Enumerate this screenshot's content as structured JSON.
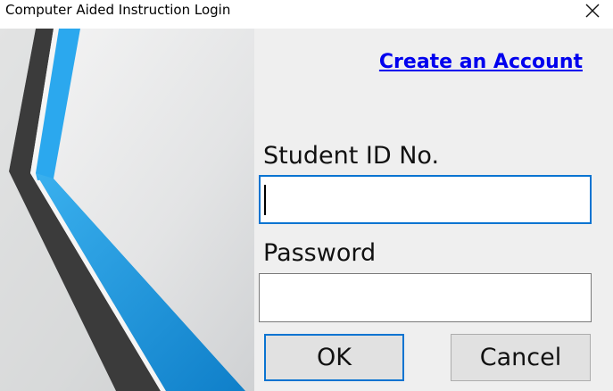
{
  "window": {
    "title": "Computer Aided Instruction Login"
  },
  "icons": {
    "close": "close-icon"
  },
  "links": {
    "create_account": "Create an Account"
  },
  "form": {
    "student_id_label": "Student ID No.",
    "student_id_value": "",
    "password_label": "Password",
    "password_value": ""
  },
  "buttons": {
    "ok": "OK",
    "cancel": "Cancel"
  },
  "colors": {
    "accent": "#0a74d1",
    "link": "#0000ee",
    "stripe_blue": "#1f8fd8",
    "stripe_light_blue": "#2ba8ee",
    "stripe_dark": "#3a3a3a"
  }
}
